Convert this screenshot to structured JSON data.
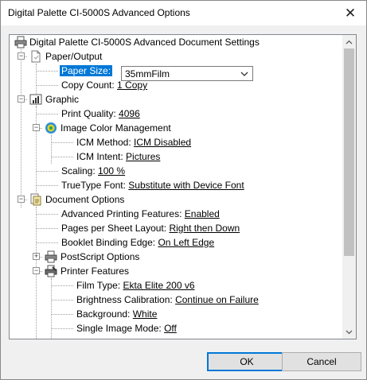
{
  "window": {
    "title": "Digital Palette CI-5000S Advanced Options",
    "close_glyph": "✕"
  },
  "tree": {
    "root": "Digital Palette CI-5000S Advanced Document Settings",
    "paper_output": {
      "label": "Paper/Output",
      "paper_size": {
        "label": "Paper Size:",
        "value": "35mmFilm"
      },
      "copy_count": {
        "label": "Copy Count:",
        "value": "1 Copy"
      }
    },
    "graphic": {
      "label": "Graphic",
      "print_quality": {
        "label": "Print Quality:",
        "value": "4096"
      },
      "icm": {
        "label": "Image Color Management",
        "method": {
          "label": "ICM Method:",
          "value": "ICM Disabled"
        },
        "intent": {
          "label": "ICM Intent:",
          "value": "Pictures"
        }
      },
      "scaling": {
        "label": "Scaling:",
        "value": "100 %"
      },
      "truetype": {
        "label": "TrueType Font:",
        "value": "Substitute with Device Font"
      }
    },
    "document_options": {
      "label": "Document Options",
      "advanced_printing": {
        "label": "Advanced Printing Features:",
        "value": "Enabled"
      },
      "pages_layout": {
        "label": "Pages per Sheet Layout:",
        "value": "Right then Down"
      },
      "booklet": {
        "label": "Booklet Binding Edge:",
        "value": "On Left Edge"
      },
      "postscript": {
        "label": "PostScript Options"
      },
      "printer_features": {
        "label": "Printer Features",
        "film_type": {
          "label": "Film Type:",
          "value": "Ekta Elite 200 v6"
        },
        "brightness": {
          "label": "Brightness Calibration:",
          "value": "Continue on Failure"
        },
        "background": {
          "label": "Background:",
          "value": "White"
        },
        "single_image": {
          "label": "Single Image Mode:",
          "value": "Off"
        }
      }
    }
  },
  "buttons": {
    "ok": "OK",
    "cancel": "Cancel"
  },
  "icons": [
    "printer-icon",
    "page-icon",
    "graphic-icon",
    "color-wheel-icon",
    "document-options-icon",
    "chevron-down-icon",
    "close-icon"
  ],
  "colors": {
    "selection": "#0078d7",
    "dialog_bg": "#f0f0f0",
    "scroll_thumb": "#c1c1c1"
  }
}
